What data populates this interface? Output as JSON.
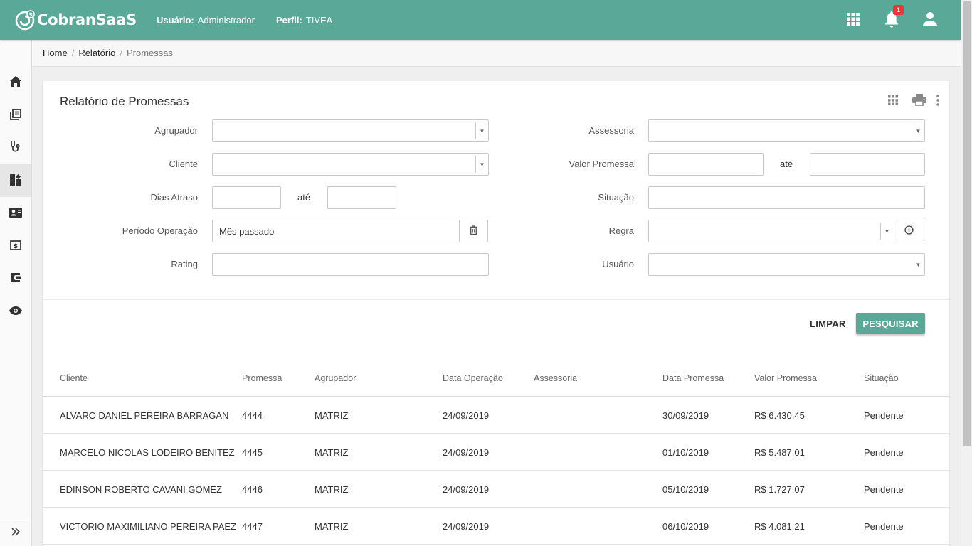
{
  "header": {
    "brand": "CobranSaaS",
    "user_label": "Usuário:",
    "user_value": "Administrador",
    "profile_label": "Perfil:",
    "profile_value": "TIVEA",
    "notification_count": "1",
    "icons": [
      "apps-grid-icon",
      "bell-icon",
      "user-icon"
    ],
    "colors": {
      "primary": "#5aa898",
      "badge": "#e53935"
    }
  },
  "sidebar": {
    "items": [
      {
        "icon": "home-icon"
      },
      {
        "icon": "library-books-icon"
      },
      {
        "icon": "stethoscope-icon"
      },
      {
        "icon": "dashboard-icon",
        "active": true
      },
      {
        "icon": "contact-card-icon"
      },
      {
        "icon": "money-icon"
      },
      {
        "icon": "wallet-icon"
      },
      {
        "icon": "eye-icon"
      }
    ],
    "toggle_icon": "double-chevron-right-icon"
  },
  "breadcrumb": {
    "items": [
      "Home",
      "Relatório"
    ],
    "current": "Promessas"
  },
  "card": {
    "title": "Relatório de Promessas",
    "tool_icons": [
      "grid-icon",
      "print-icon",
      "more-vert-icon"
    ]
  },
  "filters": {
    "agrupador": {
      "label": "Agrupador",
      "value": ""
    },
    "cliente": {
      "label": "Cliente",
      "value": ""
    },
    "dias_atraso": {
      "label": "Dias Atraso",
      "from": "",
      "to_label": "até",
      "to": ""
    },
    "periodo_operacao": {
      "label": "Período Operação",
      "value": "Mês passado"
    },
    "rating": {
      "label": "Rating",
      "value": ""
    },
    "assessoria": {
      "label": "Assessoria",
      "value": ""
    },
    "valor_promessa": {
      "label": "Valor Promessa",
      "from": "",
      "to_label": "até",
      "to": ""
    },
    "situacao": {
      "label": "Situação",
      "value": ""
    },
    "regra": {
      "label": "Regra",
      "value": ""
    },
    "usuario": {
      "label": "Usuário",
      "value": ""
    }
  },
  "actions": {
    "clear": "LIMPAR",
    "search": "PESQUISAR"
  },
  "table": {
    "columns": [
      "Cliente",
      "Promessa",
      "Agrupador",
      "Data Operação",
      "Assessoria",
      "Data Promessa",
      "Valor Promessa",
      "Situação"
    ],
    "rows": [
      [
        "ALVARO DANIEL PEREIRA BARRAGAN",
        "4444",
        "MATRIZ",
        "24/09/2019",
        "",
        "30/09/2019",
        "R$ 6.430,45",
        "Pendente"
      ],
      [
        "MARCELO NICOLAS LODEIRO BENITEZ",
        "4445",
        "MATRIZ",
        "24/09/2019",
        "",
        "01/10/2019",
        "R$ 5.487,01",
        "Pendente"
      ],
      [
        "EDINSON ROBERTO CAVANI GOMEZ",
        "4446",
        "MATRIZ",
        "24/09/2019",
        "",
        "05/10/2019",
        "R$ 1.727,07",
        "Pendente"
      ],
      [
        "VICTORIO MAXIMILIANO PEREIRA PAEZ",
        "4447",
        "MATRIZ",
        "24/09/2019",
        "",
        "06/10/2019",
        "R$ 4.081,21",
        "Pendente"
      ]
    ]
  }
}
